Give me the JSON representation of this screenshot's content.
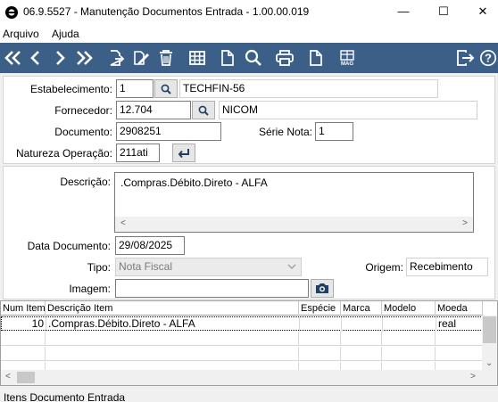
{
  "window": {
    "title": "06.9.5527 - Manutenção Documentos Entrada - 1.00.00.019",
    "minimize": "—",
    "maximize": "☐",
    "close": "✕"
  },
  "menu": {
    "items": [
      "Arquivo",
      "Ajuda"
    ]
  },
  "toolbar": {
    "buttons": [
      "first-icon",
      "previous-icon",
      "next-icon",
      "last-icon",
      "new-record-icon",
      "edit-icon",
      "delete-icon",
      "grid-icon",
      "blank-document-icon",
      "search-icon",
      "print-icon",
      "copy-document-icon",
      "mag-icon",
      "exit-icon",
      "help-icon"
    ],
    "mag_label": "MAG",
    "help_label": "?"
  },
  "header": {
    "estabelecimento_label": "Estabelecimento:",
    "estabelecimento_code": "1",
    "estabelecimento_name": "TECHFIN-56",
    "fornecedor_label": "Fornecedor:",
    "fornecedor_code": "12.704",
    "fornecedor_name": "NICOM",
    "documento_label": "Documento:",
    "documento_value": "2908251",
    "serie_label": "Série Nota:",
    "serie_value": "1",
    "natureza_label": "Natureza Operação:",
    "natureza_value": "211ati"
  },
  "details": {
    "descricao_label": "Descrição:",
    "descricao_value": ".Compras.Débito.Direto - ALFA",
    "data_label": "Data Documento:",
    "data_value": "29/08/2025",
    "tipo_label": "Tipo:",
    "tipo_value": "Nota Fiscal",
    "origem_label": "Origem:",
    "origem_value": "Recebimento",
    "imagem_label": "Imagem:",
    "imagem_value": ""
  },
  "grid": {
    "columns": [
      "Num Item",
      "Descrição Item",
      "Espécie",
      "Marca",
      "Modelo",
      "Moeda"
    ],
    "rows": [
      [
        "10",
        ".Compras.Débito.Direto - ALFA",
        "",
        "",
        "",
        "real"
      ]
    ]
  },
  "status": {
    "text": "Itens Documento Entrada"
  },
  "colors": {
    "toolbar_bg": "#3c5f87",
    "window_bg": "#f0f0f0"
  }
}
